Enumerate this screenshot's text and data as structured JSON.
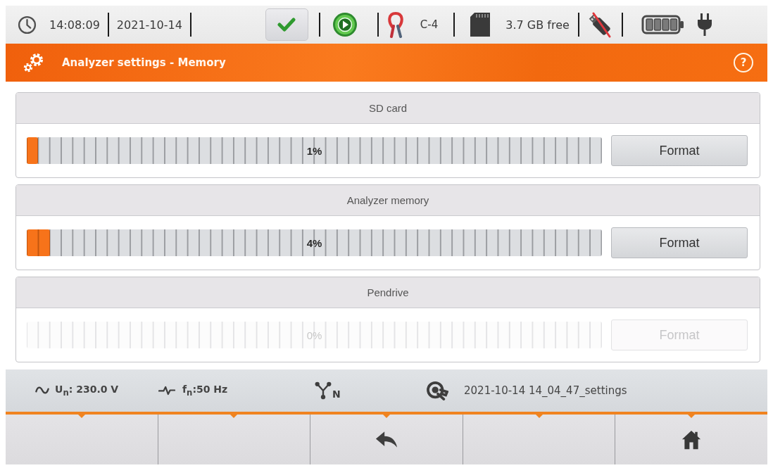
{
  "status_bar": {
    "time": "14:08:09",
    "date": "2021-10-14",
    "clamp": "C-4",
    "sd_free": "3.7 GB free"
  },
  "title_bar": {
    "title": "Analyzer settings - Memory",
    "help": "?"
  },
  "storage": [
    {
      "name": "SD card",
      "level": 0.01,
      "reading": "1%",
      "button": "Format",
      "disabled": false
    },
    {
      "name": "Analyzer memory",
      "level": 0.04,
      "reading": "4%",
      "button": "Format",
      "disabled": false
    },
    {
      "name": "Pendrive",
      "reading": "0%",
      "button": "Format",
      "disabled": true
    }
  ],
  "info_bar": {
    "voltage": "U$_{n}$: 230.0 V",
    "frequency": "f$_{n}$:50 Hz",
    "network": "N",
    "settings_file": "2021-10-14 14_04_47_settings"
  },
  "function_keys": [
    {
      "kind": "blank"
    },
    {
      "kind": "blank"
    },
    {
      "kind": "back"
    },
    {
      "kind": "blank"
    },
    {
      "kind": "home"
    }
  ]
}
